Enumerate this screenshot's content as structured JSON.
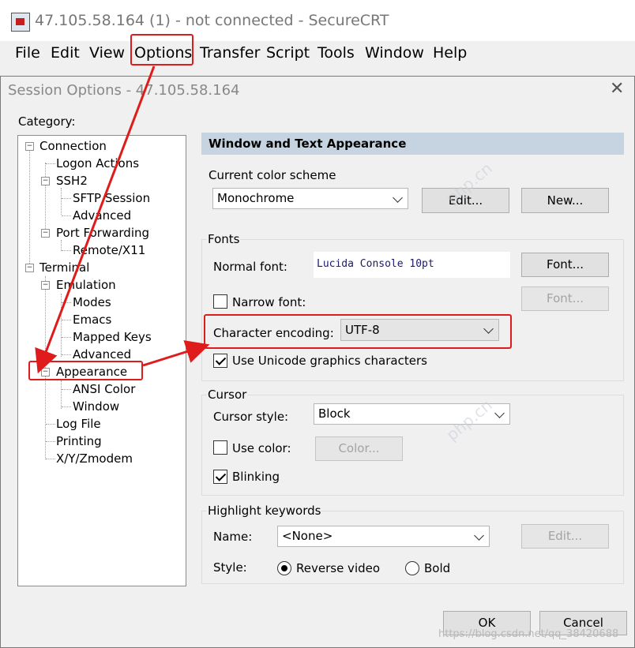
{
  "window": {
    "title": "47.105.58.164 (1) - not connected - SecureCRT"
  },
  "menubar": {
    "items": [
      "File",
      "Edit",
      "View",
      "Options",
      "Transfer",
      "Script",
      "Tools",
      "Window",
      "Help"
    ]
  },
  "dialog": {
    "title": "Session Options - 47.105.58.164",
    "category_label": "Category:",
    "tree": [
      "Connection",
      "Logon Actions",
      "SSH2",
      "SFTP Session",
      "Advanced",
      "Port Forwarding",
      "Remote/X11",
      "Terminal",
      "Emulation",
      "Modes",
      "Emacs",
      "Mapped Keys",
      "Advanced",
      "Appearance",
      "ANSI Color",
      "Window",
      "Log File",
      "Printing",
      "X/Y/Zmodem"
    ],
    "panel_title": "Window and Text Appearance",
    "color_scheme": {
      "label": "Current color scheme",
      "value": "Monochrome",
      "edit": "Edit...",
      "new": "New..."
    },
    "fonts": {
      "label": "Fonts",
      "normal_label": "Normal font:",
      "normal_value": "Lucida Console 10pt",
      "font_btn": "Font...",
      "narrow_label": "Narrow font:",
      "narrow_btn": "Font...",
      "encoding_label": "Character encoding:",
      "encoding_value": "UTF-8",
      "unicode_label": "Use Unicode graphics characters"
    },
    "cursor": {
      "label": "Cursor",
      "style_label": "Cursor style:",
      "style_value": "Block",
      "color_label": "Use color:",
      "color_btn": "Color...",
      "blink_label": "Blinking"
    },
    "highlight": {
      "label": "Highlight keywords",
      "name_label": "Name:",
      "name_value": "<None>",
      "edit": "Edit...",
      "style_label": "Style:",
      "reverse": "Reverse video",
      "bold": "Bold"
    },
    "ok": "OK",
    "cancel": "Cancel"
  },
  "watermark": {
    "text": "https://blog.csdn.net/qq_38420688",
    "site": "php.cn"
  },
  "colors": {
    "annotation": "#e01b1b",
    "panel_header": "#c6d3e0"
  }
}
